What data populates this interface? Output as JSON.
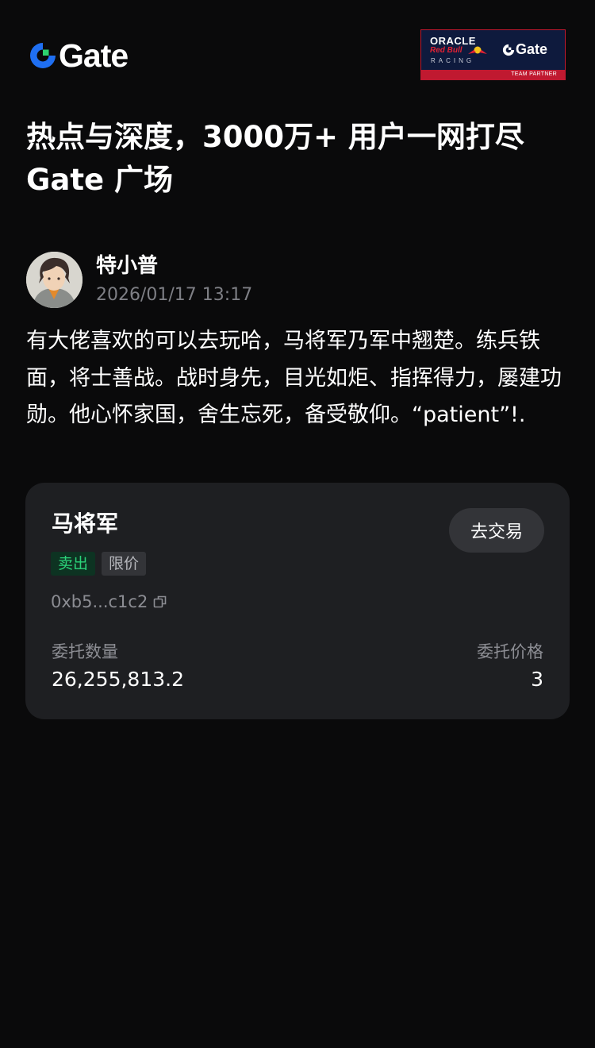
{
  "brand": {
    "logo_icon": "gate-logo-icon",
    "name": "Gate",
    "accent_color": "#1f6ff2",
    "accent_green": "#2dd36f"
  },
  "partner_badge": {
    "oracle": "ORACLE",
    "redbull": "Red Bull",
    "racing": "RACING",
    "gate": "Gate",
    "strip": "TEAM PARTNER",
    "bull_icon": "red-bull-icon"
  },
  "headline": "热点与深度，3000万+ 用户一网打尽 Gate 广场",
  "post": {
    "author": "特小普",
    "timestamp": "2026/01/17 13:17",
    "body": "有大佬喜欢的可以去玩哈，马将军乃军中翘楚。练兵铁面，将士善战。战时身先，目光如炬、指挥得力，屡建功勋。他心怀家国，舍生忘死，备受敬仰。“patient”!."
  },
  "trade_card": {
    "token_name": "马将军",
    "trade_button": "去交易",
    "tag_side": "卖出",
    "tag_type": "限价",
    "address": "0xb5...c1c2",
    "qty_label": "委托数量",
    "qty_value": "26,255,813.2",
    "price_label": "委托价格",
    "price_value": "3",
    "sell_color": "#2bd47a"
  }
}
